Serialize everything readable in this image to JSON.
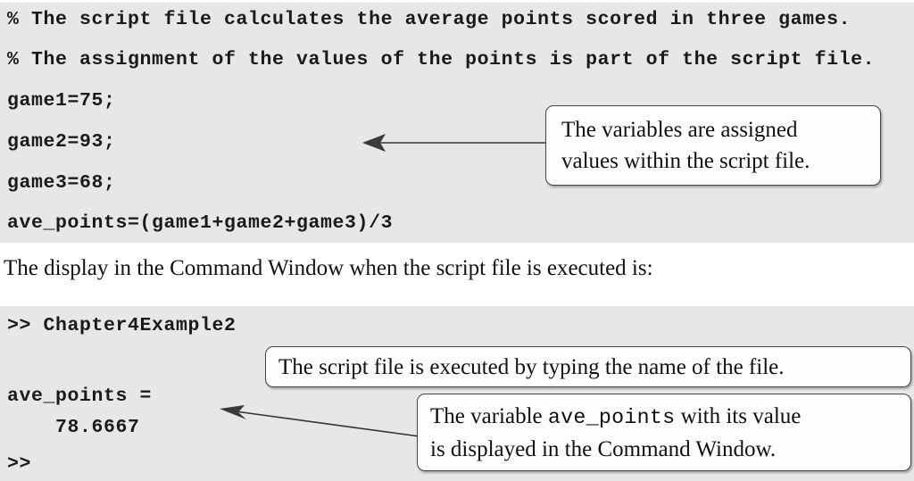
{
  "script_block": {
    "name": "script-file-listing",
    "lines": [
      "% The script file calculates the average points scored in three games.",
      "% The assignment of the values of the points is part of the script file.",
      "game1=75;",
      "game2=93;",
      "game3=68;",
      "ave_points=(game1+game2+game3)/3"
    ]
  },
  "prose": {
    "text": "The display in the Command Window when the script file is executed is:"
  },
  "command_block": {
    "name": "command-window-output",
    "lines": [
      ">> Chapter4Example2",
      "ave_points =",
      "    78.6667",
      ">>"
    ]
  },
  "callouts": {
    "variables": {
      "line1": "The variables are assigned",
      "line2": "values within the script file."
    },
    "executed": {
      "line1": "The script file is executed by typing the name of the file."
    },
    "displayed": {
      "line1_a": "The variable",
      "line1_mono": "ave_points",
      "line1_b": "with its value",
      "line2": "is displayed in the Command Window."
    }
  },
  "colors": {
    "code_background": "#e7e7e7",
    "page_background": "#ffffff",
    "text": "#111111",
    "callout_border": "#444444",
    "arrow": "#333333"
  }
}
